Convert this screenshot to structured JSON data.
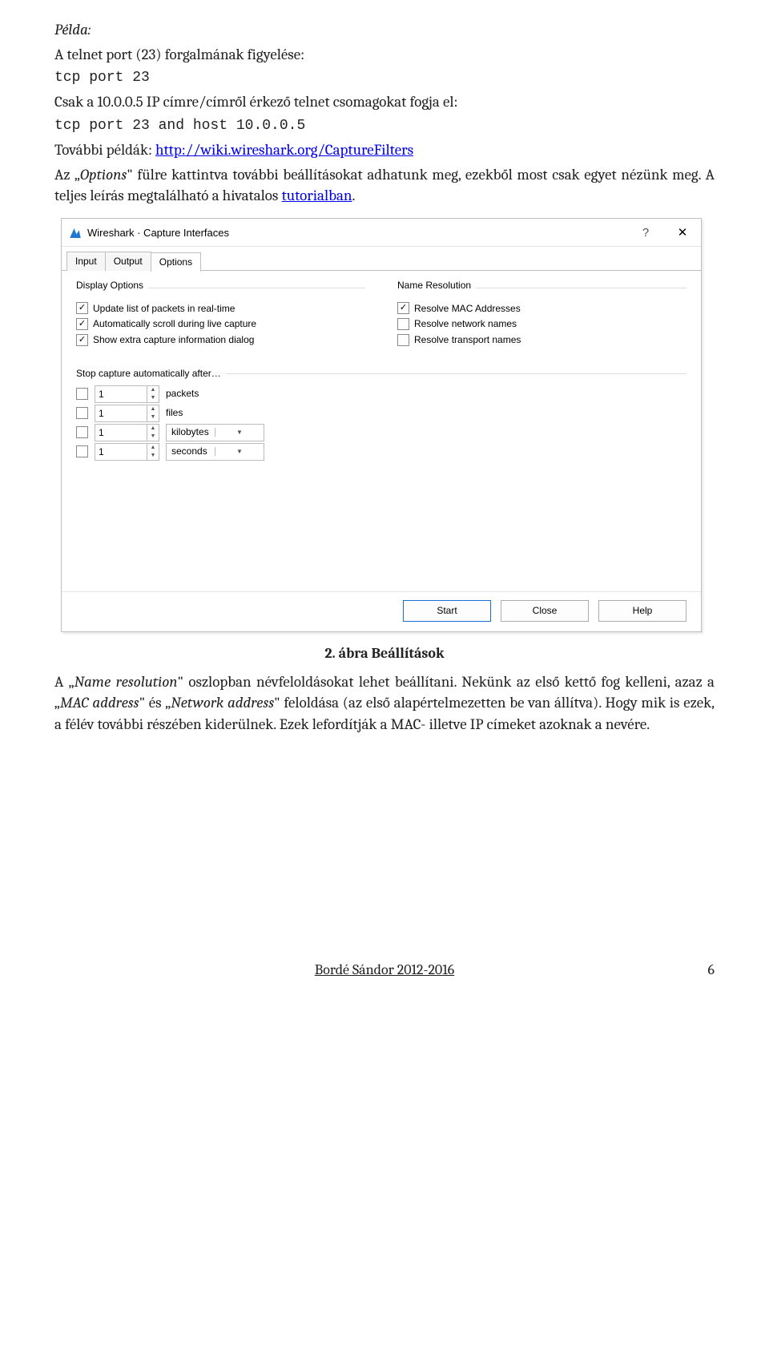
{
  "doc": {
    "example_label": "Példa:",
    "line1": "A telnet port (23) forgalmának figyelése:",
    "code1": "tcp port 23",
    "line2": "Csak a 10.0.0.5 IP címre/címről érkező telnet csomagokat fogja el:",
    "code2": "tcp port 23 and host 10.0.0.5",
    "more_examples": "További példák: ",
    "more_link": "http://wiki.wireshark.org/CaptureFilters",
    "para_after_link_pre": "Az „",
    "para_after_link_i": "Options",
    "para_after_link_post": "\" fülre kattintva további beállításokat adhatunk meg, ezekből most csak egyet nézünk meg. A teljes leírás megtalálható a hivatalos ",
    "tutorial_link": "tutorialban",
    "period": ".",
    "caption": "2. ábra Beállítások",
    "para2_pre": "A „",
    "para2_i1": "Name resolution",
    "para2_mid1": "\" oszlopban névfeloldásokat lehet beállítani. Nekünk az első kettő fog kelleni, azaz a „",
    "para2_i2": "MAC address",
    "para2_mid2": "\" és „",
    "para2_i3": "Network address",
    "para2_mid3": "\" feloldása (az első alapértelmezetten be van állítva). Hogy mik is ezek, a félév további részében kiderülnek. Ezek lefordítják a MAC- illetve IP címeket azoknak a nevére.",
    "footer_author": "Bordé Sándor 2012-2016",
    "footer_page": "6"
  },
  "ws": {
    "title": "Wireshark · Capture Interfaces",
    "help_q": "?",
    "close_x": "✕",
    "tabs": {
      "input": "Input",
      "output": "Output",
      "options": "Options"
    },
    "display_group": "Display Options",
    "name_group": "Name Resolution",
    "cb_update": "Update list of packets in real-time",
    "cb_scroll": "Automatically scroll during live capture",
    "cb_extra": "Show extra capture information dialog",
    "cb_mac": "Resolve MAC Addresses",
    "cb_net": "Resolve network names",
    "cb_trans": "Resolve transport names",
    "stop_label": "Stop capture automatically after…",
    "spin_val": "1",
    "unit_packets": "packets",
    "unit_files": "files",
    "unit_kb": "kilobytes",
    "unit_sec": "seconds",
    "btn_start": "Start",
    "btn_close": "Close",
    "btn_help": "Help"
  }
}
